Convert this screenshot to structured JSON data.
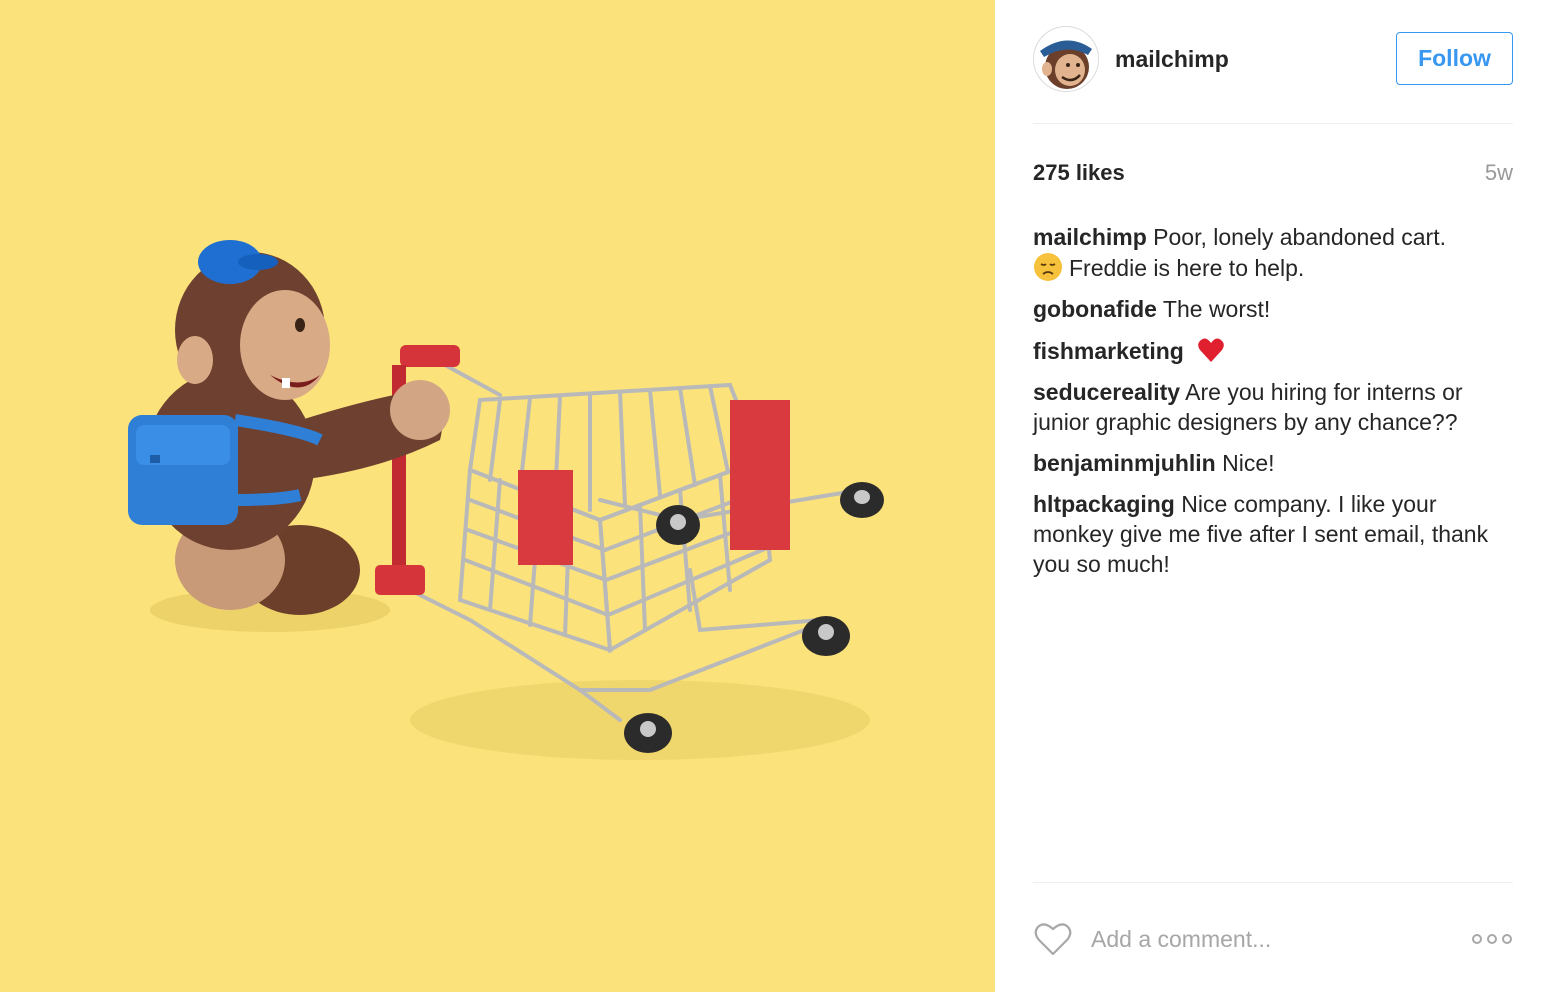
{
  "post": {
    "image_alt_icon": "monkey-with-shopping-cart-photo",
    "background_color": "#fbe27a"
  },
  "header": {
    "username": "mailchimp",
    "follow_label": "Follow",
    "avatar_icon": "freddie-avatar-icon"
  },
  "stats": {
    "likes": "275 likes",
    "time": "5w"
  },
  "caption": {
    "user": "mailchimp",
    "text_line1": "Poor, lonely abandoned cart.",
    "emoji": "disappointed-face-icon",
    "text_line2": "Freddie is here to help."
  },
  "comments": [
    {
      "user": "gobonafide",
      "text": "The worst!"
    },
    {
      "user": "fishmarketing",
      "text": "",
      "emoji": "heart-emoji-icon"
    },
    {
      "user": "seducereality",
      "text": "Are you hiring for interns or junior graphic designers by any chance??"
    },
    {
      "user": "benjaminmjuhlin",
      "text": "Nice!"
    },
    {
      "user": "hltpackaging",
      "text": "Nice company. I like your monkey give me five after I sent email, thank you so much!"
    }
  ],
  "footer": {
    "comment_placeholder": "Add a comment...",
    "like_icon": "heart-outline-icon",
    "more_icon": "more-options-icon"
  },
  "colors": {
    "accent": "#3897f0",
    "muted": "#999999",
    "text": "#262626"
  }
}
